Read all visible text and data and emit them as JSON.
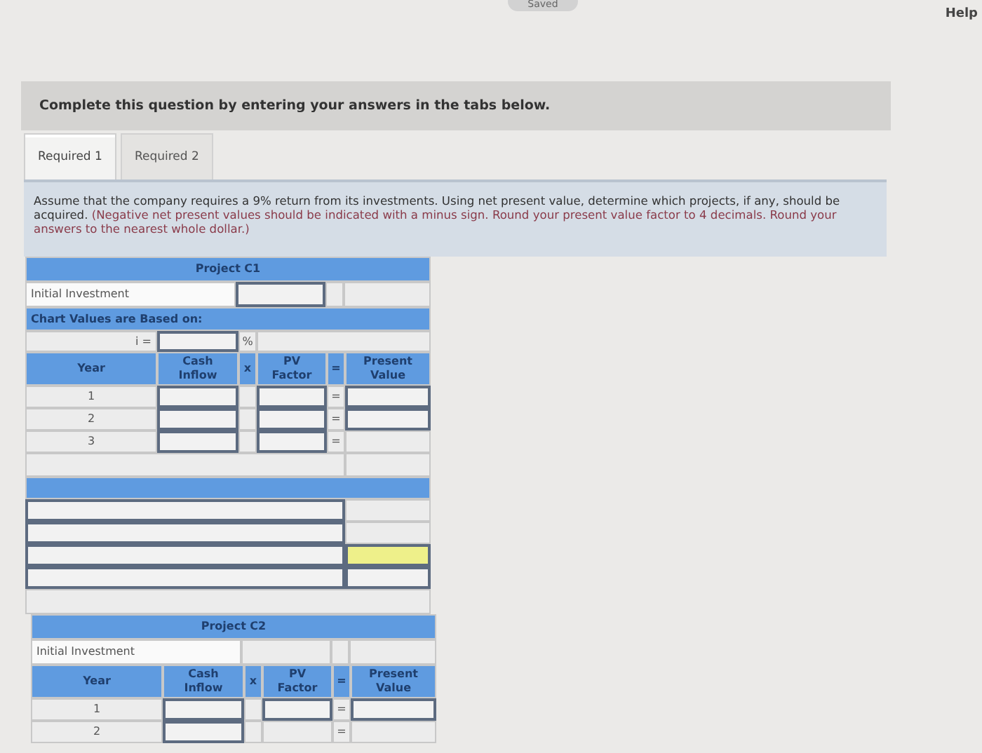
{
  "header": {
    "status": "Saved",
    "help": "Help"
  },
  "banner": "Complete this question by entering your answers in the tabs below.",
  "tabs": [
    {
      "label": "Required 1",
      "selected": true
    },
    {
      "label": "Required 2",
      "selected": false
    }
  ],
  "instructions": {
    "text": "Assume that the company requires a 9% return from its investments. Using net present value, determine which projects, if any, should be acquired.",
    "note": "(Negative net present values should be indicated with a minus sign. Round your present value factor to 4 decimals. Round your answers to the nearest whole dollar.)"
  },
  "projects": [
    {
      "title": "Project C1",
      "initial_investment_label": "Initial Investment",
      "initial_investment_input": true,
      "chart_values_label": "Chart Values are Based on:",
      "rate_label": "i =",
      "rate_unit": "%",
      "columns": [
        "Year",
        "Cash Inflow",
        "x",
        "PV Factor",
        "=",
        "Present Value"
      ],
      "rows": [
        {
          "year": "1",
          "operator": "=",
          "cash_input": true,
          "factor_input": true,
          "value_input": true
        },
        {
          "year": "2",
          "operator": "=",
          "cash_input": true,
          "factor_input": true,
          "value_input": true
        },
        {
          "year": "3",
          "operator": "=",
          "cash_input": true,
          "factor_input": true,
          "value_input": false
        }
      ],
      "summary_rows": [
        {
          "kind": "plain"
        },
        {
          "kind": "plain"
        },
        {
          "kind": "highlighted"
        },
        {
          "kind": "input"
        }
      ]
    },
    {
      "title": "Project C2",
      "initial_investment_label": "Initial Investment",
      "initial_investment_input": false,
      "columns": [
        "Year",
        "Cash Inflow",
        "x",
        "PV Factor",
        "=",
        "Present Value"
      ],
      "rows": [
        {
          "year": "1",
          "operator": "=",
          "cash_input": true,
          "factor_input": true,
          "value_input": true
        },
        {
          "year": "2",
          "operator": "=",
          "cash_input": true,
          "factor_input": false,
          "value_input": false
        }
      ]
    }
  ]
}
